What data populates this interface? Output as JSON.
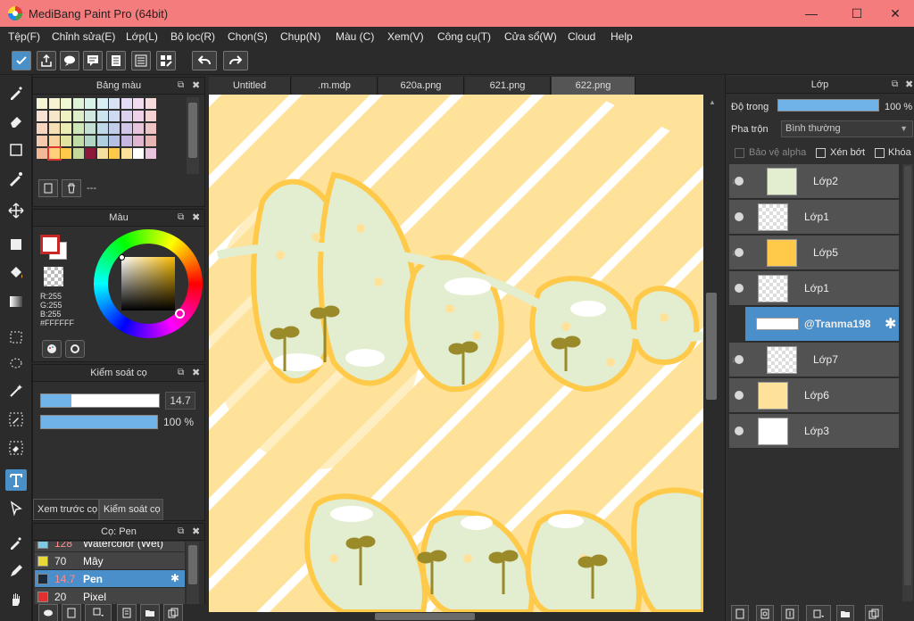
{
  "window": {
    "title": "MediBang Paint Pro (64bit)",
    "minimize": "—",
    "maximize": "☐",
    "close": "✕"
  },
  "menu": [
    "Tệp(F)",
    "Chỉnh sửa(E)",
    "Lớp(L)",
    "Bộ lọc(R)",
    "Chọn(S)",
    "Chụp(N)",
    "Màu (C)",
    "Xem(V)",
    "Công cụ(T)",
    "Cửa sổ(W)",
    "Cloud",
    "Help"
  ],
  "tabs": [
    "Untitled",
    ".m.mdp",
    "620a.png",
    "621.png",
    "622.png"
  ],
  "active_tab": "622.png",
  "palette_panel": {
    "title": "Bảng màu",
    "footer_text": "---"
  },
  "color_panel": {
    "title": "Màu",
    "r": "R:255",
    "g": "G:255",
    "b": "B:255",
    "hex": "#FFFFFF"
  },
  "brush_control": {
    "title": "Kiểm soát cọ",
    "size": "14.7",
    "opacity": "100 %",
    "size_fraction": 0.26,
    "opacity_fraction": 1.0
  },
  "preview_tabs": {
    "preview": "Xem trước cọ",
    "control": "Kiểm soát cọ"
  },
  "brush_list": {
    "title": "Cọ: Pen",
    "items": [
      {
        "size": "128",
        "name": "Watercolor (Wet)",
        "color": "#7ec8e3"
      },
      {
        "size": "70",
        "name": "Mây",
        "color": "#e8d838"
      },
      {
        "size": "14.7",
        "name": "Pen",
        "color": "#1d2a3a"
      },
      {
        "size": "20",
        "name": "Pixel",
        "color": "#e03030"
      }
    ],
    "selected": "Pen"
  },
  "layer_panel": {
    "title": "Lớp",
    "opacity_label": "Độ trong",
    "opacity_value": "100 %",
    "blend_label": "Pha trộn",
    "blend_value": "Bình thường",
    "protect_alpha": "Bảo vệ alpha",
    "clip": "Xén bớt",
    "lock": "Khóa",
    "layers": [
      {
        "name": "Lớp2",
        "clipped": true
      },
      {
        "name": "Lớp1",
        "clipped": false
      },
      {
        "name": "Lớp5",
        "clipped": true
      },
      {
        "name": "Lớp1",
        "clipped": false
      },
      {
        "name": "@Tranma198",
        "clipped": false
      },
      {
        "name": "Lớp7",
        "clipped": true
      },
      {
        "name": "Lớp6",
        "clipped": false
      },
      {
        "name": "Lớp3",
        "clipped": false
      }
    ],
    "selected_index": 4
  },
  "colors": {
    "accent": "#4a8fc9",
    "titlebar": "#f57c7c",
    "canvas_yellow": "#ffe29a",
    "canvas_green": "#e3edcf",
    "canvas_orange": "#ffc94a"
  },
  "icons": [
    "select-icon",
    "eraser-icon",
    "rect-select-icon",
    "brush-icon",
    "move-icon",
    "fill-rect-icon",
    "bucket-icon",
    "gradient-icon",
    "select-marquee-icon",
    "lasso-icon",
    "magic-wand-icon",
    "select-pen-icon",
    "select-eraser-icon",
    "text-icon",
    "operation-icon",
    "eyedropper-icon",
    "pen-icon",
    "hand-icon"
  ]
}
